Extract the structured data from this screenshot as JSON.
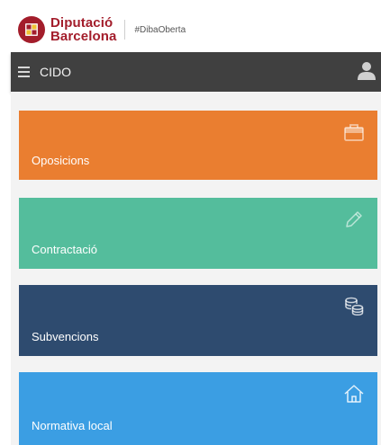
{
  "brand": {
    "name_line1": "Diputació",
    "name_line2": "Barcelona",
    "hashtag": "#DibaOberta",
    "accent_color": "#a31d2b"
  },
  "topbar": {
    "title": "CIDO",
    "menu_icon": "hamburger-menu-icon",
    "user_icon": "user-icon",
    "background": "#404040"
  },
  "tiles": [
    {
      "label": "Oposicions",
      "icon": "briefcase-icon",
      "color": "#ea7e30"
    },
    {
      "label": "Contractació",
      "icon": "pencil-icon",
      "color": "#54bd9c"
    },
    {
      "label": "Subvencions",
      "icon": "coins-icon",
      "color": "#2e4b6f"
    },
    {
      "label": "Normativa local",
      "icon": "house-icon",
      "color": "#3b9ee3"
    }
  ]
}
